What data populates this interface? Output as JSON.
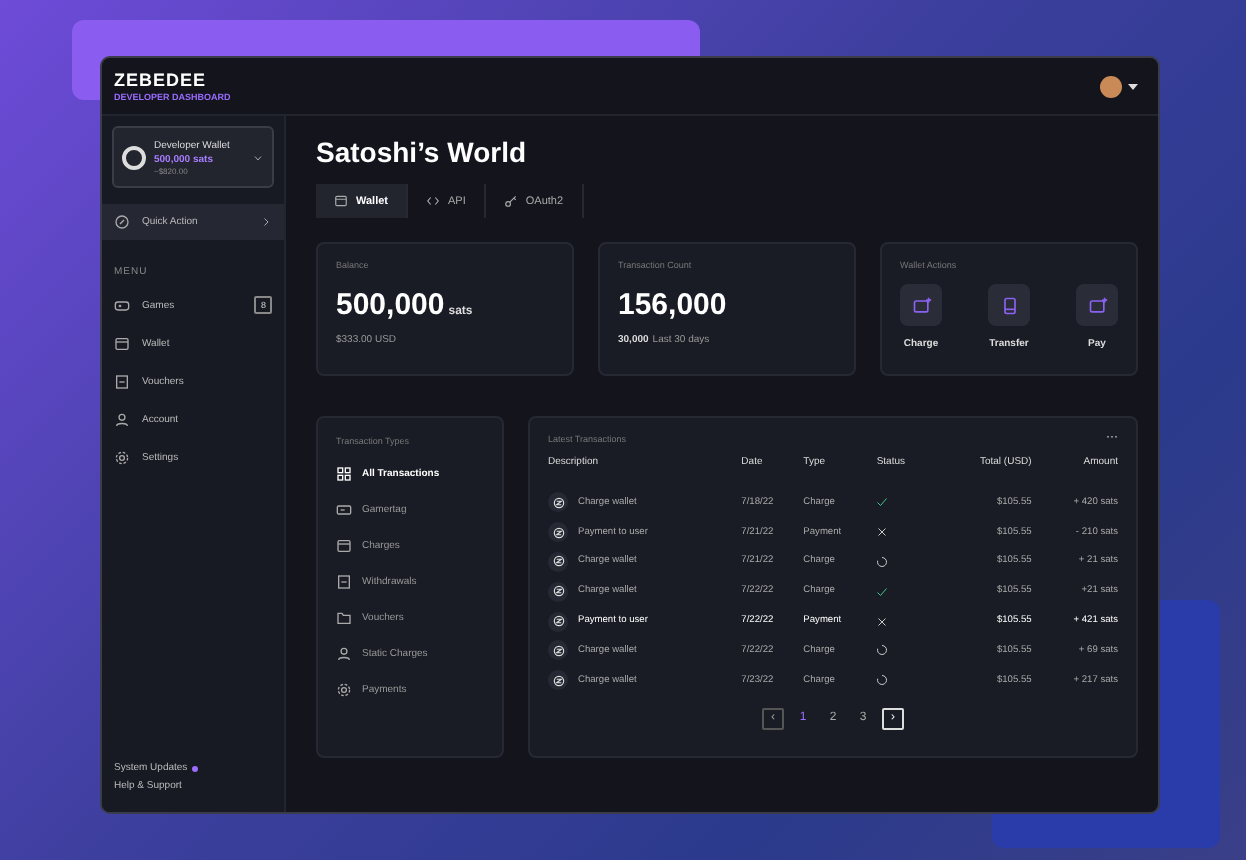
{
  "brand": {
    "name": "ZEBEDEE",
    "subtitle": "DEVELOPER DASHBOARD"
  },
  "wallet_card": {
    "name": "Developer Wallet",
    "balance": "500,000 sats",
    "fiat": "~$820.00"
  },
  "quick_action": {
    "label": "Quick Action",
    "highlighted": true
  },
  "menu": {
    "heading": "MENU",
    "items": [
      {
        "label": "Games",
        "kind": "gamepad",
        "badge": "8"
      },
      {
        "label": "Wallet",
        "kind": "wallet"
      },
      {
        "label": "Vouchers",
        "kind": "doc"
      },
      {
        "label": "Account",
        "kind": "user"
      },
      {
        "label": "Settings",
        "kind": "gear"
      }
    ]
  },
  "footer_links": [
    {
      "label": "System Updates",
      "dot": true
    },
    {
      "label": "Help & Support",
      "dot": false
    }
  ],
  "page_title": "Satoshi’s World",
  "tabs": [
    {
      "label": "Wallet",
      "kind": "wallet",
      "selected": true
    },
    {
      "label": "API",
      "kind": "code",
      "selected": false
    },
    {
      "label": "OAuth2",
      "kind": "key",
      "selected": false
    }
  ],
  "balance": {
    "label": "Balance",
    "value": "500,000",
    "unit": "sats",
    "fiat": "$333.00 USD"
  },
  "transaction_count": {
    "label": "Transaction Count",
    "value": "156,000",
    "recent": "30,000",
    "recent_label": "Last 30 days"
  },
  "wallet_actions": {
    "label": "Wallet Actions",
    "actions": [
      {
        "label": "Charge",
        "kind": "charge"
      },
      {
        "label": "Transfer",
        "kind": "phone"
      },
      {
        "label": "Pay",
        "kind": "charge"
      }
    ]
  },
  "transaction_types": {
    "heading": "Transaction Types",
    "items": [
      {
        "label": "All Transactions",
        "kind": "grid",
        "selected": true
      },
      {
        "label": "Gamertag",
        "kind": "tag",
        "selected": false
      },
      {
        "label": "Charges",
        "kind": "wallet",
        "selected": false
      },
      {
        "label": "Withdrawals",
        "kind": "doc",
        "selected": false
      },
      {
        "label": "Vouchers",
        "kind": "folder",
        "selected": false
      },
      {
        "label": "Static Charges",
        "kind": "user",
        "selected": false
      },
      {
        "label": "Payments",
        "kind": "gear",
        "selected": false
      }
    ]
  },
  "latest_transactions": {
    "title": "Latest Transactions",
    "more": "···",
    "columns": [
      "Description",
      "Date",
      "Type",
      "Status",
      "Total (USD)",
      "Amount"
    ],
    "rows": [
      {
        "description": "Charge wallet",
        "date": "7/18/22",
        "type": "Charge",
        "kind": "success",
        "total": "$105.55",
        "amount": "+ 420 sats",
        "highlighted": false
      },
      {
        "description": "Payment to user",
        "date": "7/21/22",
        "type": "Payment",
        "kind": "failed",
        "total": "$105.55",
        "amount": "- 210 sats",
        "highlighted": false
      },
      {
        "description": "Charge wallet",
        "date": "7/21/22",
        "type": "Charge",
        "kind": "pending",
        "total": "$105.55",
        "amount": "+ 21 sats",
        "highlighted": false
      },
      {
        "description": "Charge wallet",
        "date": "7/22/22",
        "type": "Charge",
        "kind": "success",
        "total": "$105.55",
        "amount": "+21 sats",
        "highlighted": false
      },
      {
        "description": "Payment to user",
        "date": "7/22/22",
        "type": "Payment",
        "kind": "failed",
        "total": "$105.55",
        "amount": "+ 421 sats",
        "highlighted": true
      },
      {
        "description": "Charge wallet",
        "date": "7/22/22",
        "type": "Charge",
        "kind": "pending",
        "total": "$105.55",
        "amount": "+ 69 sats",
        "highlighted": false
      },
      {
        "description": "Charge wallet",
        "date": "7/23/22",
        "type": "Charge",
        "kind": "pending",
        "total": "$105.55",
        "amount": "+ 217 sats",
        "highlighted": false
      }
    ],
    "pagination": {
      "prev": "‹",
      "next": "›",
      "pages": [
        {
          "label": "1",
          "selected": true
        },
        {
          "label": "2",
          "selected": false
        },
        {
          "label": "3",
          "selected": false
        }
      ]
    }
  }
}
